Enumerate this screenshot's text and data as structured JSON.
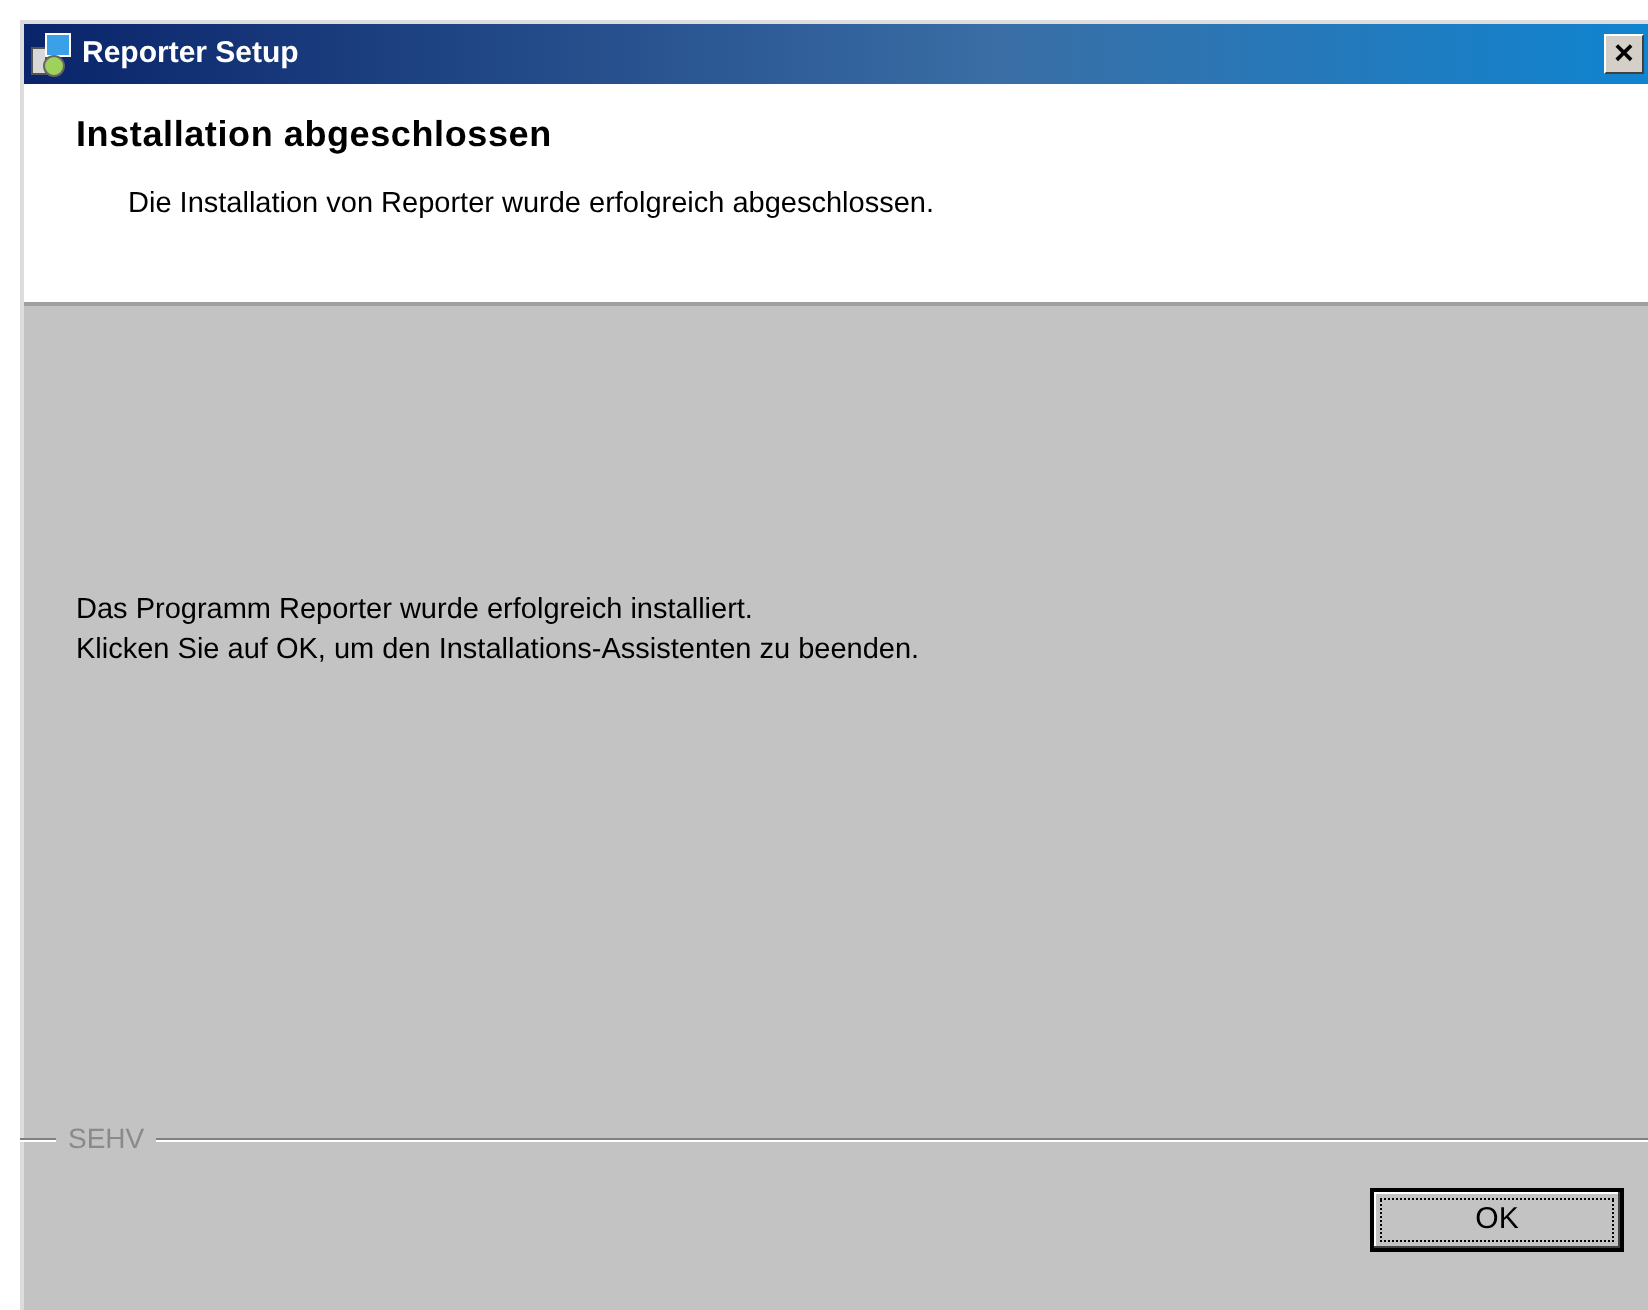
{
  "window": {
    "title": "Reporter Setup",
    "close": "×"
  },
  "header": {
    "title": "Installation abgeschlossen",
    "subtitle": "Die Installation von Reporter wurde erfolgreich abgeschlossen."
  },
  "body": {
    "lines": [
      "Das Programm Reporter wurde erfolgreich installiert.",
      "Klicken Sie auf OK, um den Installations-Assistenten zu beenden."
    ]
  },
  "footer": {
    "brand": "SEHV",
    "buttons": [
      {
        "label": "OK",
        "focused": true
      }
    ]
  }
}
